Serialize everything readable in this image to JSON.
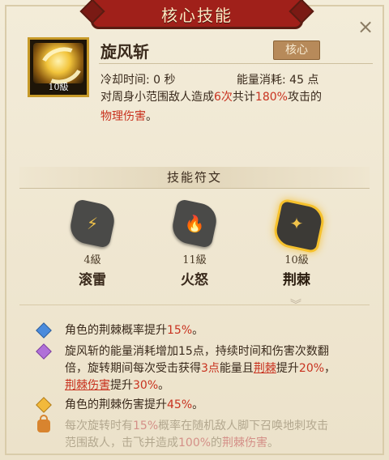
{
  "header": {
    "title": "核心技能",
    "close_label": "×"
  },
  "skill": {
    "icon": "whirlwind-icon",
    "level": "10級",
    "name": "旋风斩",
    "tag": "核心",
    "cooldown": "冷却时间: 0 秒",
    "energy": "能量消耗: 45 点",
    "desc_pre": "对周身小范围敌人造成",
    "desc_times": "6次",
    "desc_mid": "共计",
    "desc_pct": "180%",
    "desc_post": "攻击的",
    "desc_type": "物理伤害",
    "desc_end": "。"
  },
  "runes": {
    "title": "技能符文",
    "items": [
      {
        "level": "4級",
        "name": "滚雷",
        "icon": "thunder-rune-icon",
        "symbol": "⚡"
      },
      {
        "level": "11級",
        "name": "火怒",
        "icon": "fire-rune-icon",
        "symbol": "🔥"
      },
      {
        "level": "10級",
        "name": "荆棘",
        "icon": "thorn-rune-icon",
        "symbol": "✦"
      }
    ]
  },
  "effects": {
    "e1": {
      "a": "角色的荆棘概率提升",
      "b": "15%",
      "c": "。"
    },
    "e2": {
      "l1": "旋风斩的能量消耗增加15点，持续时间和伤害次数翻",
      "l2a": "倍，旋转期间每次受击获得",
      "l2b": "3点",
      "l2c": "能量且",
      "l2d": "荆棘",
      "l2e": "提升",
      "l2f": "20%",
      "l2g": "，",
      "l3a": "荆棘伤害",
      "l3b": "提升",
      "l3c": "30%",
      "l3d": "。"
    },
    "e3": {
      "a": "角色的荆棘伤害提升",
      "b": "45%",
      "c": "。"
    },
    "e4": {
      "l1a": "每次旋转时有",
      "l1b": "15%",
      "l1c": "概率在随机敌人脚下召唤地刺攻击",
      "l2a": "范围敌人，击飞并造成",
      "l2b": "100%",
      "l2c": "的",
      "l2d": "荆棘伤害",
      "l2e": "。"
    }
  },
  "colors": {
    "accent_red": "#c8321f",
    "banner": "#a0201a",
    "gold": "#f6c12c"
  }
}
